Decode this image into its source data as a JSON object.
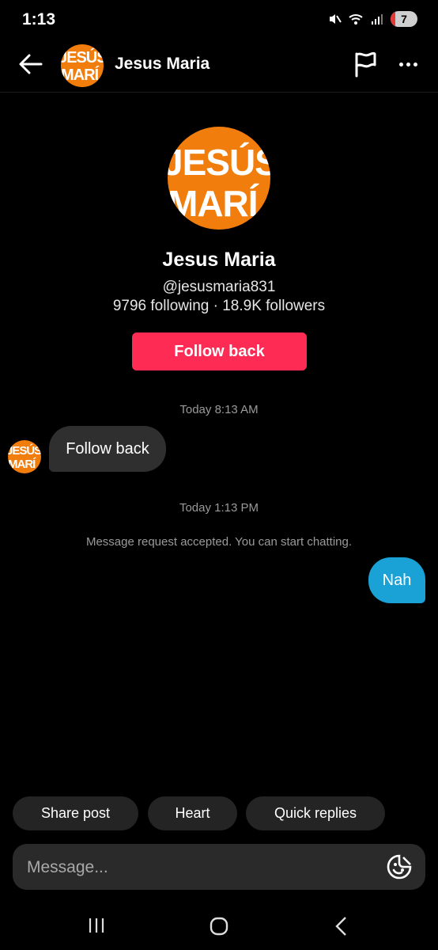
{
  "status_bar": {
    "time": "1:13",
    "battery": "7"
  },
  "header": {
    "title": "Jesus Maria"
  },
  "avatar_text": {
    "line1": "JESÚS",
    "line2": "MARÍ"
  },
  "profile": {
    "name": "Jesus Maria",
    "handle": "@jesusmaria831",
    "stats": "9796 following · 18.9K followers",
    "follow_button": "Follow back"
  },
  "messages": {
    "timestamp_1": "Today 8:13 AM",
    "incoming_1": "Follow back",
    "timestamp_2": "Today 1:13 PM",
    "system": "Message request accepted. You can start chatting.",
    "outgoing_1": "Nah"
  },
  "quick_actions": [
    "Share post",
    "Heart",
    "Quick replies"
  ],
  "composer": {
    "placeholder": "Message..."
  },
  "colors": {
    "follow": "#fe2c55",
    "outgoing_bubble": "#1aa1d6",
    "avatar_bg": "#f07d0c"
  }
}
